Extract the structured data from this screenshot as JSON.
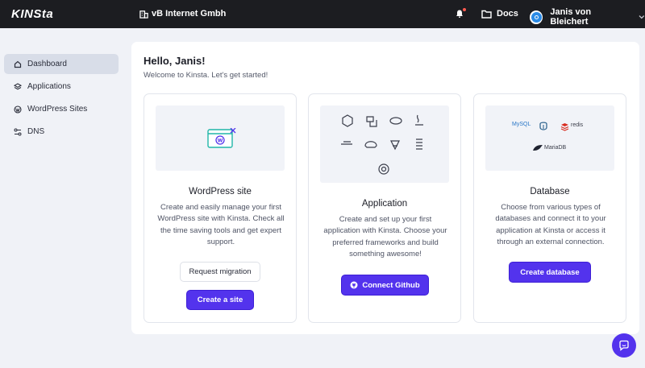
{
  "topbar": {
    "logo": "KINSta",
    "company": "vB Internet Gmbh",
    "docs_label": "Docs",
    "user_name": "Janis von Bleichert"
  },
  "sidebar": {
    "items": [
      {
        "label": "Dashboard",
        "icon": "home-icon",
        "active": true
      },
      {
        "label": "Applications",
        "icon": "layers-icon",
        "active": false
      },
      {
        "label": "WordPress Sites",
        "icon": "wordpress-icon",
        "active": false
      },
      {
        "label": "DNS",
        "icon": "dns-icon",
        "active": false
      }
    ]
  },
  "main": {
    "greeting": "Hello, Janis!",
    "welcome": "Welcome to Kinsta. Let's get started!",
    "cards": [
      {
        "title": "WordPress site",
        "description": "Create and easily manage your first WordPress site with Kinsta. Check all the time saving tools and get expert support.",
        "secondary_button": "Request migration",
        "primary_button": "Create a site"
      },
      {
        "title": "Application",
        "description": "Create and set up your first application with Kinsta. Choose your preferred frameworks and build something awesome!",
        "primary_button": "Connect Github"
      },
      {
        "title": "Database",
        "description": "Choose from various types of databases and connect it to your application at Kinsta or access it through an external connection.",
        "primary_button": "Create database"
      }
    ],
    "db_labels": {
      "mysql": "MySQL",
      "redis": "redis",
      "mariadb": "MariaDB"
    }
  },
  "colors": {
    "accent": "#5333ed",
    "topbar": "#1c1d21",
    "background": "#f0f2f7"
  }
}
